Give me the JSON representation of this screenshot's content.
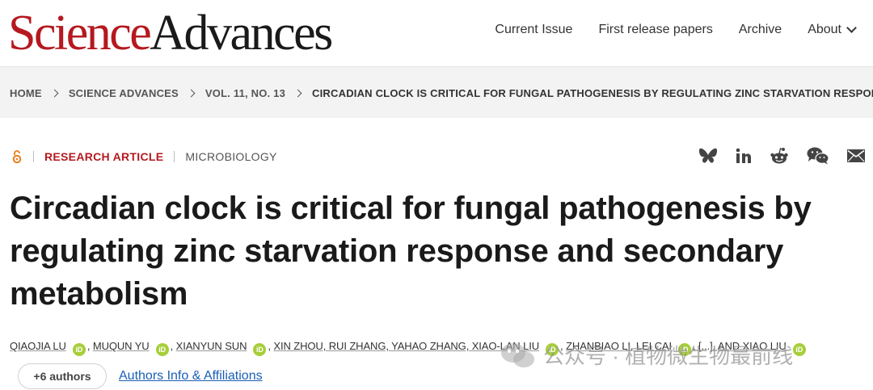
{
  "header": {
    "logo_science": "Science",
    "logo_advances": "Advances",
    "nav": [
      "Current Issue",
      "First release papers",
      "Archive",
      "About"
    ]
  },
  "breadcrumb": [
    "HOME",
    "SCIENCE ADVANCES",
    "VOL. 11, NO. 13",
    "CIRCADIAN CLOCK IS CRITICAL FOR FUNGAL PATHOGENESIS BY REGULATING ZINC STARVATION RESPONSE..."
  ],
  "article": {
    "type": "RESEARCH ARTICLE",
    "subject": "MICROBIOLOGY",
    "title": "Circadian clock is critical for fungal pathogenesis by regulating zinc starvation response and secondary metabolism",
    "authors_a": [
      "QIAOJIA LU",
      "MUQUN YU",
      "XIANYUN SUN"
    ],
    "authors_b": "XIN ZHOU, RUI ZHANG, YAHAO ZHANG, XIAO-LAN LIU",
    "authors_c": "ZHANBIAO LI, LEI CAI",
    "authors_ellipsis": "[...]",
    "authors_last": "AND XIAO LIU",
    "orcid_label": "iD",
    "more_authors": "+6 authors",
    "affiliations_link": "Authors Info & Affiliations"
  },
  "share_icons": [
    "bluesky-icon",
    "linkedin-icon",
    "reddit-icon",
    "wechat-icon",
    "email-icon"
  ],
  "watermark": "公众号 · 植物微生物最前线",
  "colors": {
    "brand_red": "#b5191f",
    "link_blue": "#1a5fb4",
    "orcid_green": "#a6ce39"
  }
}
